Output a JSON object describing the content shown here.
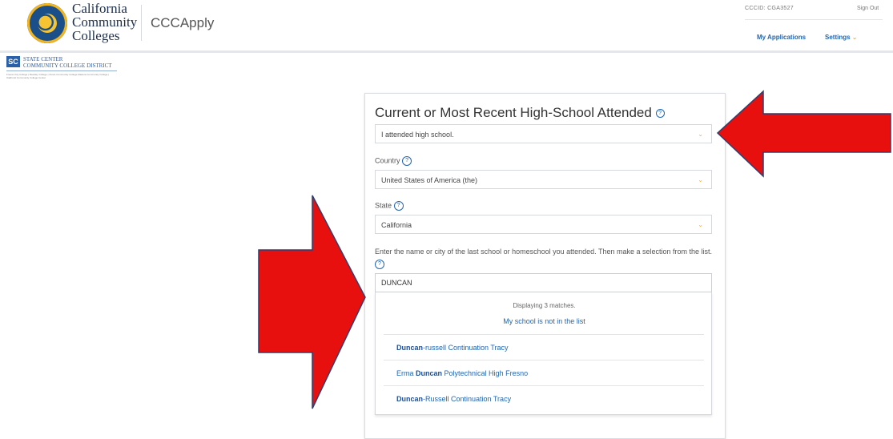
{
  "header": {
    "logo_lines": [
      "California",
      "Community",
      "Colleges"
    ],
    "app_name": "CCCApply",
    "ccc_id": "CCCID: CGA3527",
    "sign_out": "Sign Out",
    "my_applications": "My Applications",
    "settings": "Settings"
  },
  "district": {
    "abbr": "SC",
    "name_line1": "STATE CENTER",
    "name_line2": "COMMUNITY COLLEGE DISTRICT",
    "subtitle": "Fresno City College | Reedley College | Clovis Community College Madera Community College | Oakhurst Community College Center"
  },
  "form": {
    "title": "Current or Most Recent High-School Attended",
    "attendance_select": "I attended high school.",
    "country_label": "Country",
    "country_select": "United States of America (the)",
    "state_label": "State",
    "state_select": "California",
    "instructions": "Enter the name or city of the last school or homeschool you attended. Then make a selection from the list.",
    "search_value": "DUNCAN",
    "match_count": "Displaying 3 matches.",
    "not_in_list": "My school is not in the list",
    "results": [
      {
        "prefix": "",
        "highlight": "Duncan",
        "suffix": "-russell Continuation Tracy"
      },
      {
        "prefix": "Erma ",
        "highlight": "Duncan",
        "suffix": " Polytechnical High Fresno"
      },
      {
        "prefix": "",
        "highlight": "Duncan",
        "suffix": "-Russell Continuation Tracy"
      }
    ]
  },
  "icons": {
    "help": "?",
    "chevron": "⌄"
  },
  "colors": {
    "link_blue": "#2266b0",
    "arrow_red": "#e8100e",
    "chevron_orange": "#f2b23a"
  }
}
